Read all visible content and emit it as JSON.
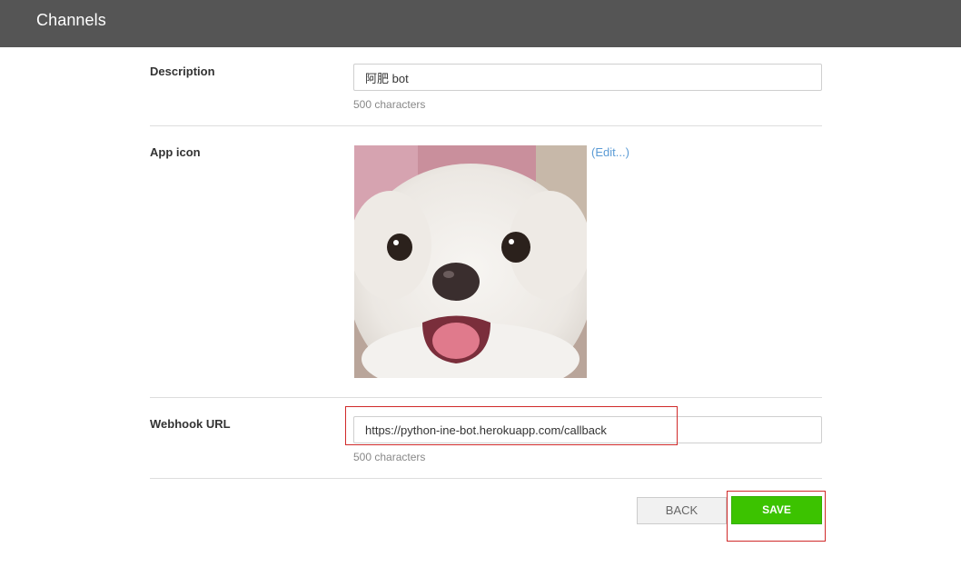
{
  "header": {
    "title": "Channels"
  },
  "description": {
    "label": "Description",
    "value": "阿肥 bot",
    "hint": "500 characters"
  },
  "app_icon": {
    "label": "App icon",
    "image_semantic": "white-dog-face-photo",
    "edit_open": "(",
    "edit_label": "Edit...",
    "edit_close": ")"
  },
  "webhook": {
    "label": "Webhook URL",
    "value": "https://python-ine-bot.herokuapp.com/callback",
    "hint": "500 characters"
  },
  "actions": {
    "back_label": "BACK",
    "save_label": "SAVE"
  },
  "colors": {
    "topbar": "#555555",
    "save_button": "#3cc300",
    "link": "#5b9bd5",
    "highlight": "#d02a2a"
  }
}
